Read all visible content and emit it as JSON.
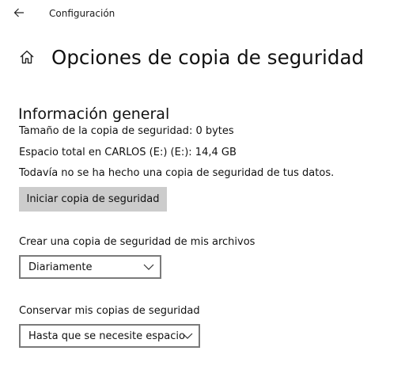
{
  "window": {
    "app_title": "Configuración"
  },
  "page": {
    "title": "Opciones de copia de seguridad"
  },
  "overview": {
    "heading": "Información general",
    "backup_size": "Tamaño de la copia de seguridad: 0 bytes",
    "total_space": "Espacio total en CARLOS (E:) (E:): 14,4 GB",
    "status": "Todavía no se ha hecho una copia de seguridad de tus datos.",
    "start_button": "Iniciar copia de seguridad"
  },
  "schedule": {
    "label": "Crear una copia de seguridad de mis archivos",
    "selected": "Diariamente"
  },
  "retention": {
    "label": "Conservar mis copias de seguridad",
    "selected": "Hasta que se necesite espacio"
  },
  "icons": {
    "back": "back-arrow-icon",
    "home": "home-icon",
    "dropdown": "chevron-down-icon"
  },
  "colors": {
    "button_bg": "#cccccc",
    "dropdown_border": "#7a7a7a",
    "text": "#111111"
  }
}
